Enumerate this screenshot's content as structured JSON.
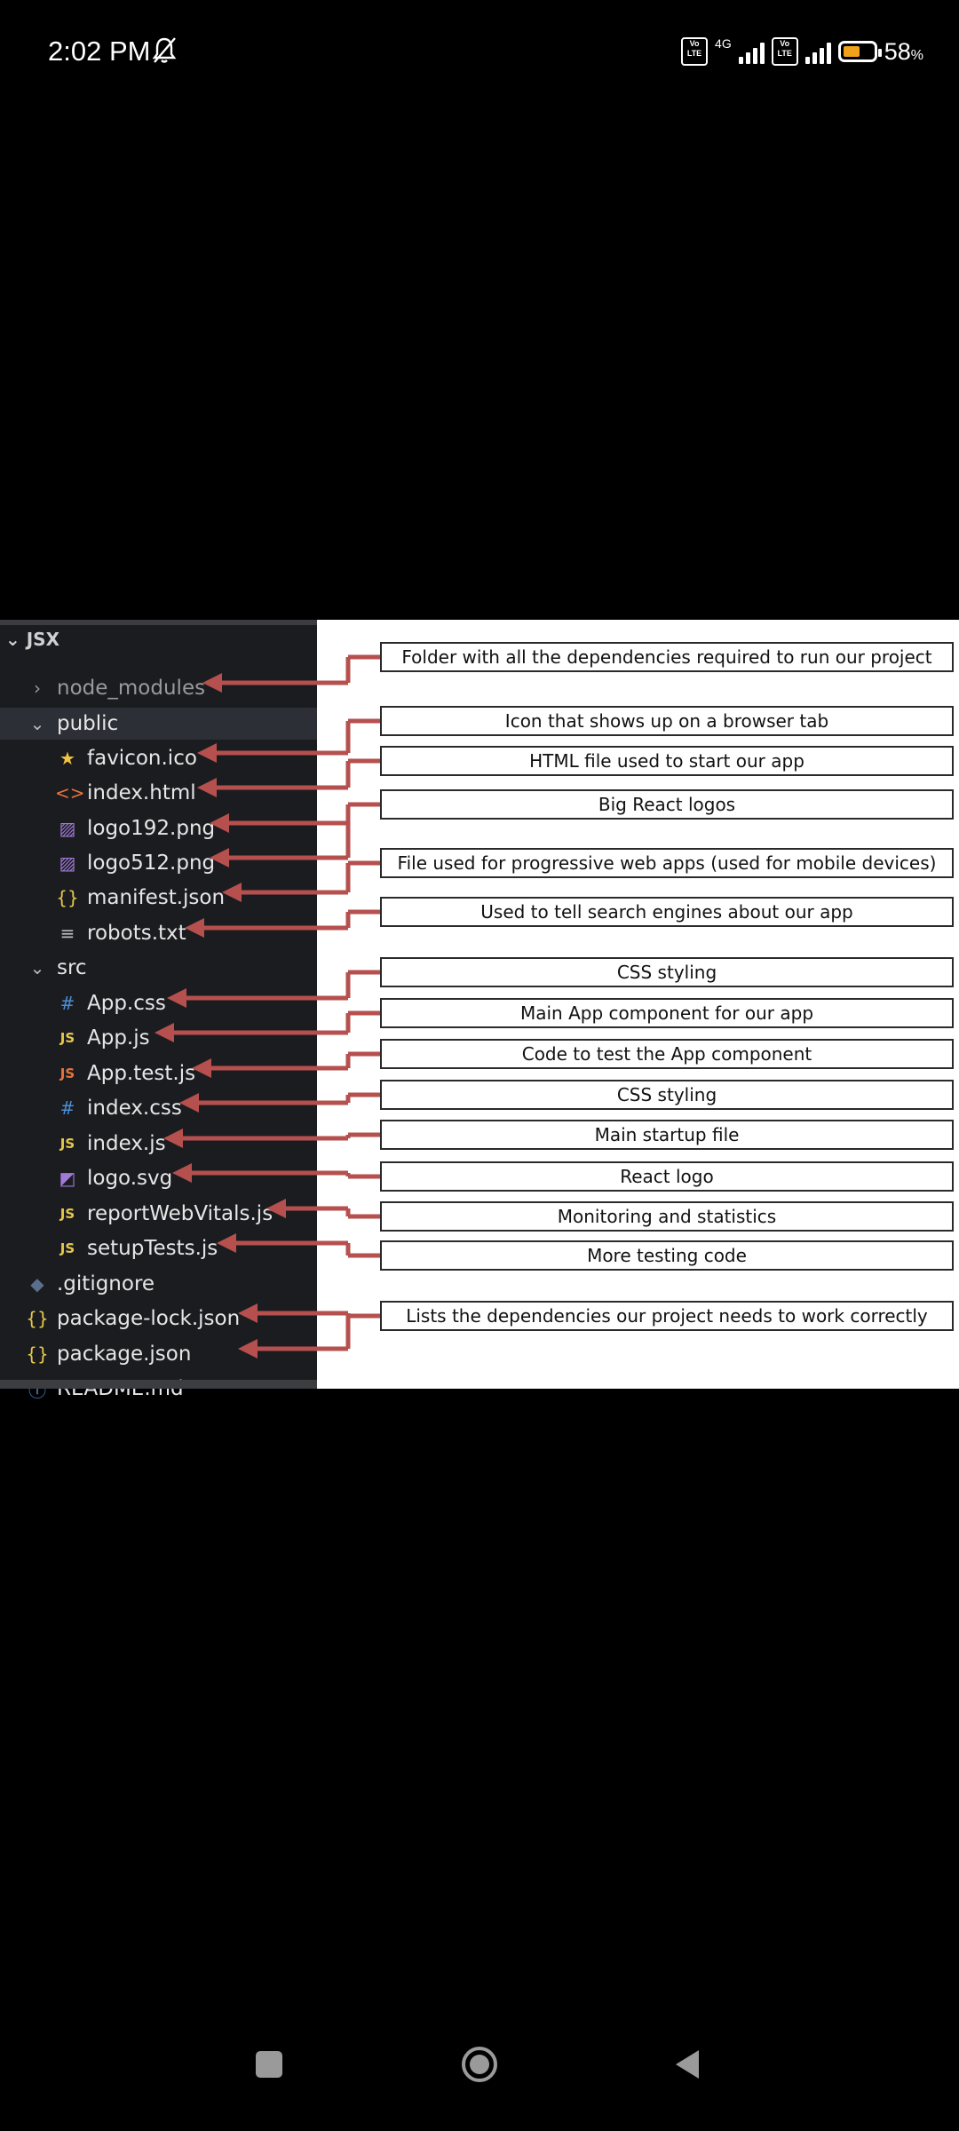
{
  "status": {
    "time": "2:02 PM",
    "network": "4G",
    "volte": "Vo LTE",
    "battery_percent": "58",
    "battery_unit": "%",
    "battery_level": 0.58
  },
  "explorer": {
    "header": "JSX",
    "items": [
      {
        "label": "node_modules",
        "icon": "chevron-right-icon",
        "glyph": "›",
        "color": "#9a9a9a",
        "dim": true
      },
      {
        "label": "public",
        "icon": "chevron-down-icon",
        "glyph": "⌄",
        "color": "#bbbbbb",
        "selected": true
      },
      {
        "label": "favicon.ico",
        "icon": "star-icon",
        "glyph": "★",
        "color": "#f5c542"
      },
      {
        "label": "index.html",
        "icon": "html-icon",
        "glyph": "<>",
        "color": "#e8743b"
      },
      {
        "label": "logo192.png",
        "icon": "image-icon",
        "glyph": "▨",
        "color": "#a07ad8"
      },
      {
        "label": "logo512.png",
        "icon": "image-icon",
        "glyph": "▨",
        "color": "#a07ad8"
      },
      {
        "label": "manifest.json",
        "icon": "json-icon",
        "glyph": "{}",
        "color": "#e6c84a"
      },
      {
        "label": "robots.txt",
        "icon": "text-lines-icon",
        "glyph": "≡",
        "color": "#bbbbbb"
      },
      {
        "label": "src",
        "icon": "chevron-down-icon",
        "glyph": "⌄",
        "color": "#bbbbbb"
      },
      {
        "label": "App.css",
        "icon": "hash-icon",
        "glyph": "#",
        "color": "#4a8fd6"
      },
      {
        "label": "App.js",
        "icon": "js-icon",
        "glyph": "JS",
        "color": "#e6c84a"
      },
      {
        "label": "App.test.js",
        "icon": "js-test-icon",
        "glyph": "JS",
        "color": "#e8743b"
      },
      {
        "label": "index.css",
        "icon": "hash-icon",
        "glyph": "#",
        "color": "#4a8fd6"
      },
      {
        "label": "index.js",
        "icon": "js-icon",
        "glyph": "JS",
        "color": "#e6c84a"
      },
      {
        "label": "logo.svg",
        "icon": "svg-file-icon",
        "glyph": "◩",
        "color": "#a07ad8"
      },
      {
        "label": "reportWebVitals.js",
        "icon": "js-icon",
        "glyph": "JS",
        "color": "#e6c84a"
      },
      {
        "label": "setupTests.js",
        "icon": "js-icon",
        "glyph": "JS",
        "color": "#e6c84a"
      },
      {
        "label": ".gitignore",
        "icon": "git-diamond-icon",
        "glyph": "◆",
        "color": "#5b6f8c"
      },
      {
        "label": "package-lock.json",
        "icon": "json-icon",
        "glyph": "{}",
        "color": "#e6c84a"
      },
      {
        "label": "package.json",
        "icon": "json-icon",
        "glyph": "{}",
        "color": "#e6c84a"
      },
      {
        "label": "README.md",
        "icon": "info-icon",
        "glyph": "ⓘ",
        "color": "#4a8fd6"
      }
    ]
  },
  "annotations": [
    "Folder with all the dependencies required to run our project",
    "Icon that shows up on a browser tab",
    "HTML file used to start our app",
    "Big React logos",
    "File used for progressive web apps (used for mobile devices)",
    "Used to tell search engines about our app",
    "CSS styling",
    "Main App component for our app",
    "Code to test the App component",
    "CSS styling",
    "Main startup file",
    "React logo",
    "Monitoring and statistics",
    "More testing code",
    "Lists the dependencies our project needs to work correctly"
  ],
  "colors": {
    "arrow": "#b6504e",
    "explorer_bg": "#1b1c20",
    "selected_row": "#2d2f36"
  },
  "nav": {
    "square": "recent-apps-icon",
    "circle": "home-icon",
    "triangle": "back-icon"
  }
}
